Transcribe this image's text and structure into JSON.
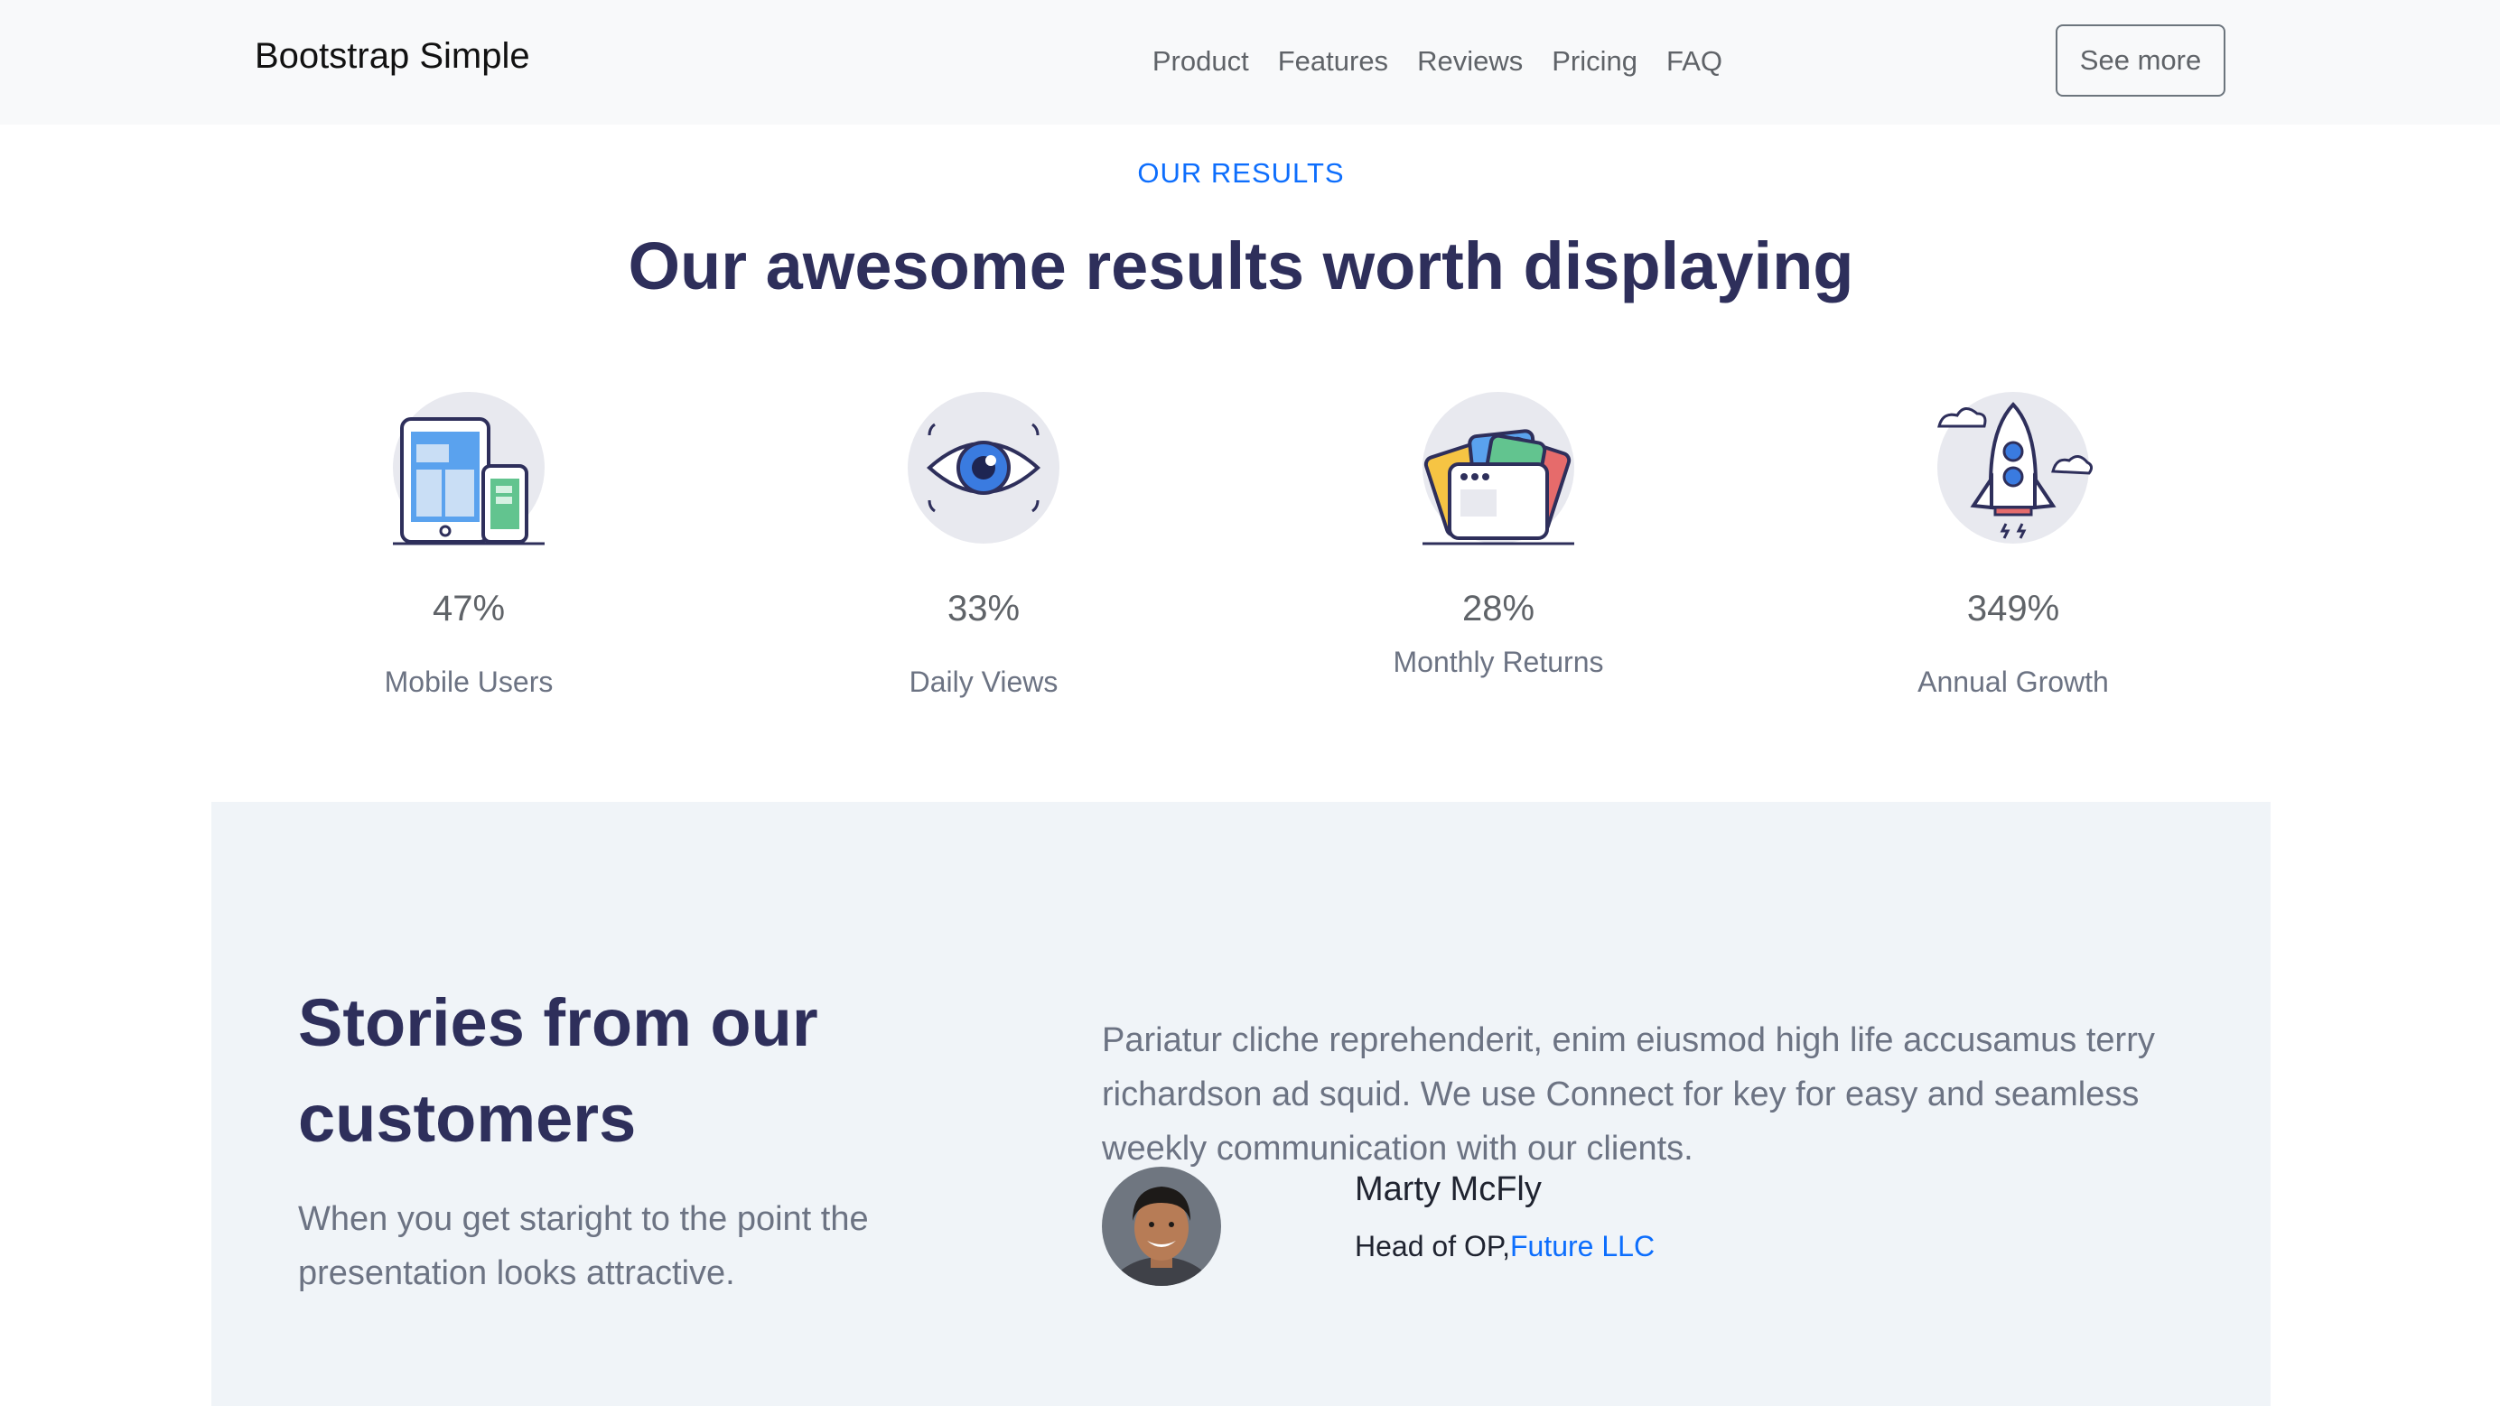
{
  "navbar": {
    "brand": "Bootstrap Simple",
    "links": [
      "Product",
      "Features",
      "Reviews",
      "Pricing",
      "FAQ"
    ],
    "button": "See more"
  },
  "results": {
    "eyebrow": "OUR RESULTS",
    "title": "Our awesome results worth displaying",
    "stats": [
      {
        "value": "47%",
        "label": "Mobile Users",
        "icon": "devices-icon"
      },
      {
        "value": "33%",
        "label": "Daily Views",
        "icon": "eye-icon"
      },
      {
        "value": "28%",
        "label": "Monthly Returns",
        "icon": "folders-icon"
      },
      {
        "value": "349%",
        "label": "Annual Growth",
        "icon": "rocket-icon"
      }
    ]
  },
  "testimonial": {
    "title": "Stories from our customers",
    "subtitle": "When you get staright to the point the presentation looks attractive.",
    "quote": "Pariatur cliche reprehenderit, enim eiusmod high life accusamus terry richardson ad squid. We use Connect for key for easy and seamless weekly communication with our clients.",
    "name": "Marty McFly",
    "role": "Head of OP,",
    "company": "Future LLC"
  },
  "colors": {
    "accent": "#0d6efd",
    "heading": "#2e2f5b",
    "navbar_bg": "#f8f9fa",
    "section_bg": "#f0f4f8"
  }
}
